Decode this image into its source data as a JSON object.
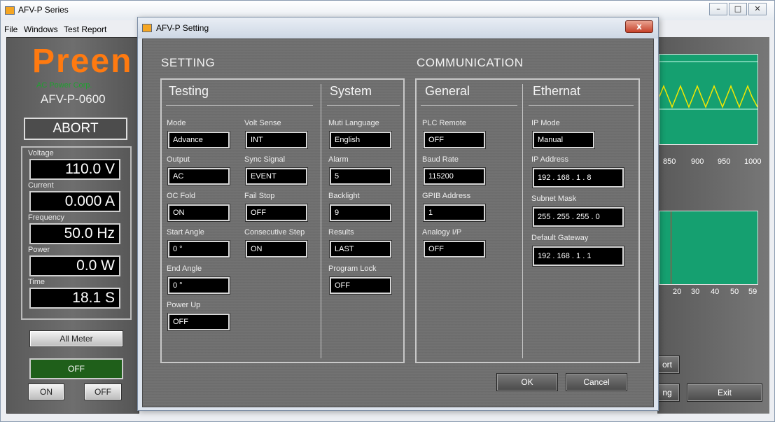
{
  "main_window": {
    "title": "AFV-P Series",
    "menu": [
      "File",
      "Windows",
      "Test Report"
    ],
    "window_controls": [
      "–",
      "□",
      "✕"
    ]
  },
  "meter_panel": {
    "brand": "Preen",
    "brand_sub": "AC Power Corp.",
    "model": "AFV-P-0600",
    "status": "ABORT",
    "readings": [
      {
        "label": "Voltage",
        "value": "110.0 V"
      },
      {
        "label": "Current",
        "value": "0.000 A"
      },
      {
        "label": "Frequency",
        "value": "50.0 Hz"
      },
      {
        "label": "Power",
        "value": "0.0 W"
      },
      {
        "label": "Time",
        "value": "18.1 S"
      }
    ],
    "all_meter_label": "All Meter",
    "output_state": "OFF",
    "on_label": "ON",
    "off_label": "OFF"
  },
  "right_panel": {
    "top_axis": [
      "850",
      "900",
      "950",
      "1000"
    ],
    "bottom_axis": [
      "20",
      "30",
      "40",
      "50",
      "59"
    ],
    "partial_button_1": "ort",
    "partial_button_2": "ng",
    "exit_label": "Exit"
  },
  "dialog": {
    "title": "AFV-P Setting",
    "close_glyph": "x",
    "setting_title": "SETTING",
    "communication_title": "COMMUNICATION",
    "testing": {
      "heading": "Testing",
      "fields": {
        "mode": {
          "label": "Mode",
          "value": "Advance"
        },
        "volt_sense": {
          "label": "Volt Sense",
          "value": "INT"
        },
        "output": {
          "label": "Output",
          "value": "AC"
        },
        "sync_signal": {
          "label": "Sync Signal",
          "value": "EVENT"
        },
        "oc_fold": {
          "label": "OC Fold",
          "value": "ON"
        },
        "fail_stop": {
          "label": "Fail Stop",
          "value": "OFF"
        },
        "start_angle": {
          "label": "Start Angle",
          "value": "0 °"
        },
        "consecutive_step": {
          "label": "Consecutive Step",
          "value": "ON"
        },
        "end_angle": {
          "label": "End Angle",
          "value": "0 °"
        },
        "power_up": {
          "label": "Power Up",
          "value": "OFF"
        }
      }
    },
    "system": {
      "heading": "System",
      "fields": {
        "language": {
          "label": "Muti Language",
          "value": "English"
        },
        "alarm": {
          "label": "Alarm",
          "value": "5"
        },
        "backlight": {
          "label": "Backlight",
          "value": "9"
        },
        "results": {
          "label": "Results",
          "value": "LAST"
        },
        "program_lock": {
          "label": "Program Lock",
          "value": "OFF"
        }
      }
    },
    "general": {
      "heading": "General",
      "fields": {
        "plc_remote": {
          "label": "PLC Remote",
          "value": "OFF"
        },
        "baud_rate": {
          "label": "Baud Rate",
          "value": "115200"
        },
        "gpib_address": {
          "label": "GPIB Address",
          "value": "1"
        },
        "analogy_ip": {
          "label": "Analogy I/P",
          "value": "OFF"
        }
      }
    },
    "ethernet": {
      "heading": "Ethernat",
      "fields": {
        "ip_mode": {
          "label": "IP Mode",
          "value": "Manual"
        },
        "ip_address": {
          "label": "IP Address",
          "value": "192 . 168 . 1    . 8"
        },
        "subnet_mask": {
          "label": "Subnet Mask",
          "value": "255 . 255 . 255 . 0"
        },
        "default_gateway": {
          "label": "Default Gateway",
          "value": "192 . 168 . 1    . 1"
        }
      }
    },
    "ok_label": "OK",
    "cancel_label": "Cancel"
  }
}
